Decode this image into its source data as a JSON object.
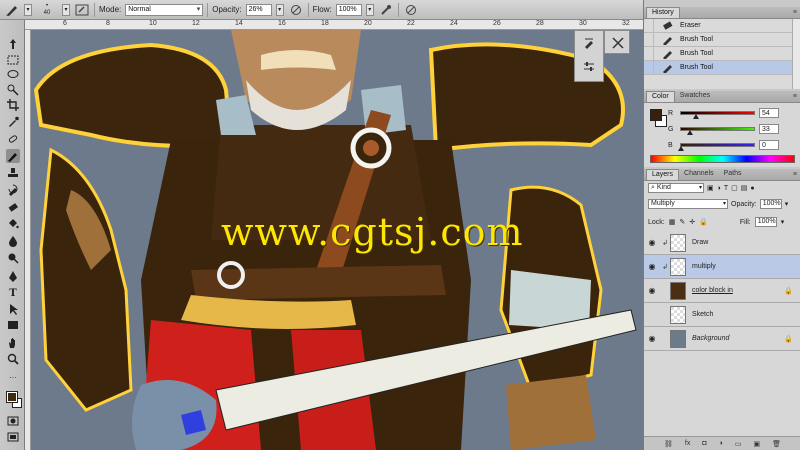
{
  "options_bar": {
    "brush_size": "40",
    "mode_label": "Mode:",
    "mode_value": "Normal",
    "opacity_label": "Opacity:",
    "opacity_value": "26%",
    "flow_label": "Flow:",
    "flow_value": "100%"
  },
  "ruler": {
    "ticks": [
      "6",
      "8",
      "10",
      "12",
      "14",
      "16",
      "18",
      "20",
      "22",
      "24",
      "26",
      "28",
      "30",
      "32"
    ]
  },
  "canvas": {
    "watermark": "www.cgtsj.com",
    "background_color": "#6d7a8c"
  },
  "history": {
    "tab": "History",
    "items": [
      {
        "label": "Eraser",
        "icon": "eraser-icon",
        "selected": false
      },
      {
        "label": "Brush Tool",
        "icon": "brush-icon",
        "selected": false
      },
      {
        "label": "Brush Tool",
        "icon": "brush-icon",
        "selected": false
      },
      {
        "label": "Brush Tool",
        "icon": "brush-icon",
        "selected": true
      }
    ]
  },
  "color_panel": {
    "tabs": [
      "Color",
      "Swatches"
    ],
    "r_label": "R",
    "g_label": "G",
    "b_label": "B",
    "r_value": "54",
    "g_value": "33",
    "b_value": "0",
    "foreground": "#36210d"
  },
  "layers_panel": {
    "tabs": [
      "Layers",
      "Channels",
      "Paths"
    ],
    "kind_label": "Kind",
    "blend_mode": "Multiply",
    "opacity_label": "Opacity:",
    "opacity_value": "100%",
    "lock_label": "Lock:",
    "fill_label": "Fill:",
    "fill_value": "100%",
    "layers": [
      {
        "name": "Draw",
        "visible": true,
        "clipped": true,
        "selected": false
      },
      {
        "name": "multiply",
        "visible": true,
        "clipped": true,
        "selected": true
      },
      {
        "name": "color block in",
        "visible": true,
        "clipped": false,
        "selected": false,
        "locked": true
      },
      {
        "name": "Sketch",
        "visible": false,
        "clipped": false,
        "selected": false
      },
      {
        "name": "Background",
        "visible": true,
        "clipped": false,
        "selected": false,
        "locked": true
      }
    ],
    "footer_icons": [
      "link-icon",
      "fx-icon",
      "mask-icon",
      "adjustment-icon",
      "folder-icon",
      "new-layer-icon",
      "trash-icon"
    ],
    "footer_labels": [
      "⛓",
      "fx",
      "◘",
      "◑",
      "▭",
      "▣",
      "🗑"
    ]
  }
}
